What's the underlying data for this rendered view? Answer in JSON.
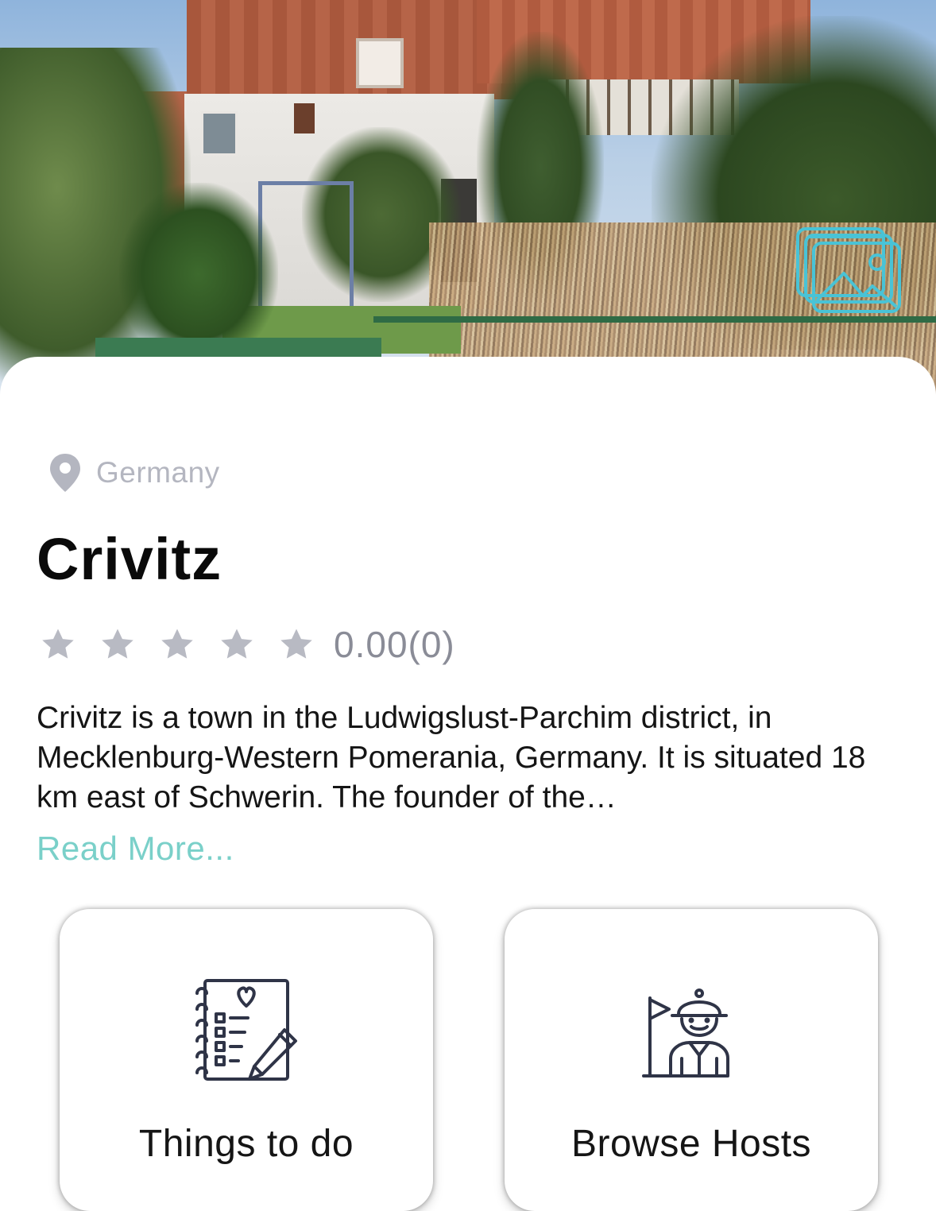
{
  "hero": {
    "image_alt": "",
    "gallery_icon": "gallery-icon"
  },
  "location": {
    "icon": "location-pin-icon",
    "country": "Germany"
  },
  "place": {
    "title": "Crivitz",
    "rating": {
      "stars_filled": 0,
      "stars_total": 5,
      "score_text": "0.00(0)"
    },
    "description": "Crivitz is a town in the Ludwigslust-Parchim district, in Mecklenburg-Western Pomerania, Germany. It is situated 18 km east of Schwerin. The founder of the…",
    "read_more": "Read More..."
  },
  "cards": [
    {
      "icon": "things-to-do-checklist-icon",
      "label": "Things to do"
    },
    {
      "icon": "tour-guide-icon",
      "label": "Browse Hosts"
    }
  ],
  "colors": {
    "accent": "#7ad0c9",
    "muted": "#b4b6c0",
    "star": "#b8bac3",
    "icon_stroke": "#2f3447",
    "gallery_icon": "#49c3d6"
  }
}
